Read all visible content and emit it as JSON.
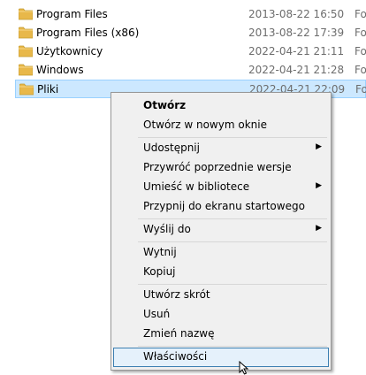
{
  "files": [
    {
      "name": "Program Files",
      "date": "2013-08-22 16:50",
      "type": "Fo",
      "icon": "folder-icon"
    },
    {
      "name": "Program Files (x86)",
      "date": "2013-08-22 17:39",
      "type": "Fo",
      "icon": "folder-icon"
    },
    {
      "name": "Użytkownicy",
      "date": "2022-04-21 21:11",
      "type": "Fo",
      "icon": "folder-icon"
    },
    {
      "name": "Windows",
      "date": "2022-04-21 21:28",
      "type": "Fo",
      "icon": "folder-icon"
    },
    {
      "name": "Pliki",
      "date": "2022-04-21 22:09",
      "type": "Fo",
      "icon": "folder-icon"
    }
  ],
  "context_menu": {
    "items": [
      {
        "label": "Otwórz"
      },
      {
        "label": "Otwórz w nowym oknie"
      },
      {
        "label": "Udostępnij"
      },
      {
        "label": "Przywróć poprzednie wersje"
      },
      {
        "label": "Umieść w bibliotece"
      },
      {
        "label": "Przypnij do ekranu startowego"
      },
      {
        "label": "Wyślij do"
      },
      {
        "label": "Wytnij"
      },
      {
        "label": "Kopiuj"
      },
      {
        "label": "Utwórz skrót"
      },
      {
        "label": "Usuń"
      },
      {
        "label": "Zmień nazwę"
      },
      {
        "label": "Właściwości"
      }
    ]
  },
  "colors": {
    "selection": "#cce8ff",
    "menu_background": "#f0f0f0",
    "menu_hover": "#e5f1fb",
    "folder": "#e8b84a"
  }
}
